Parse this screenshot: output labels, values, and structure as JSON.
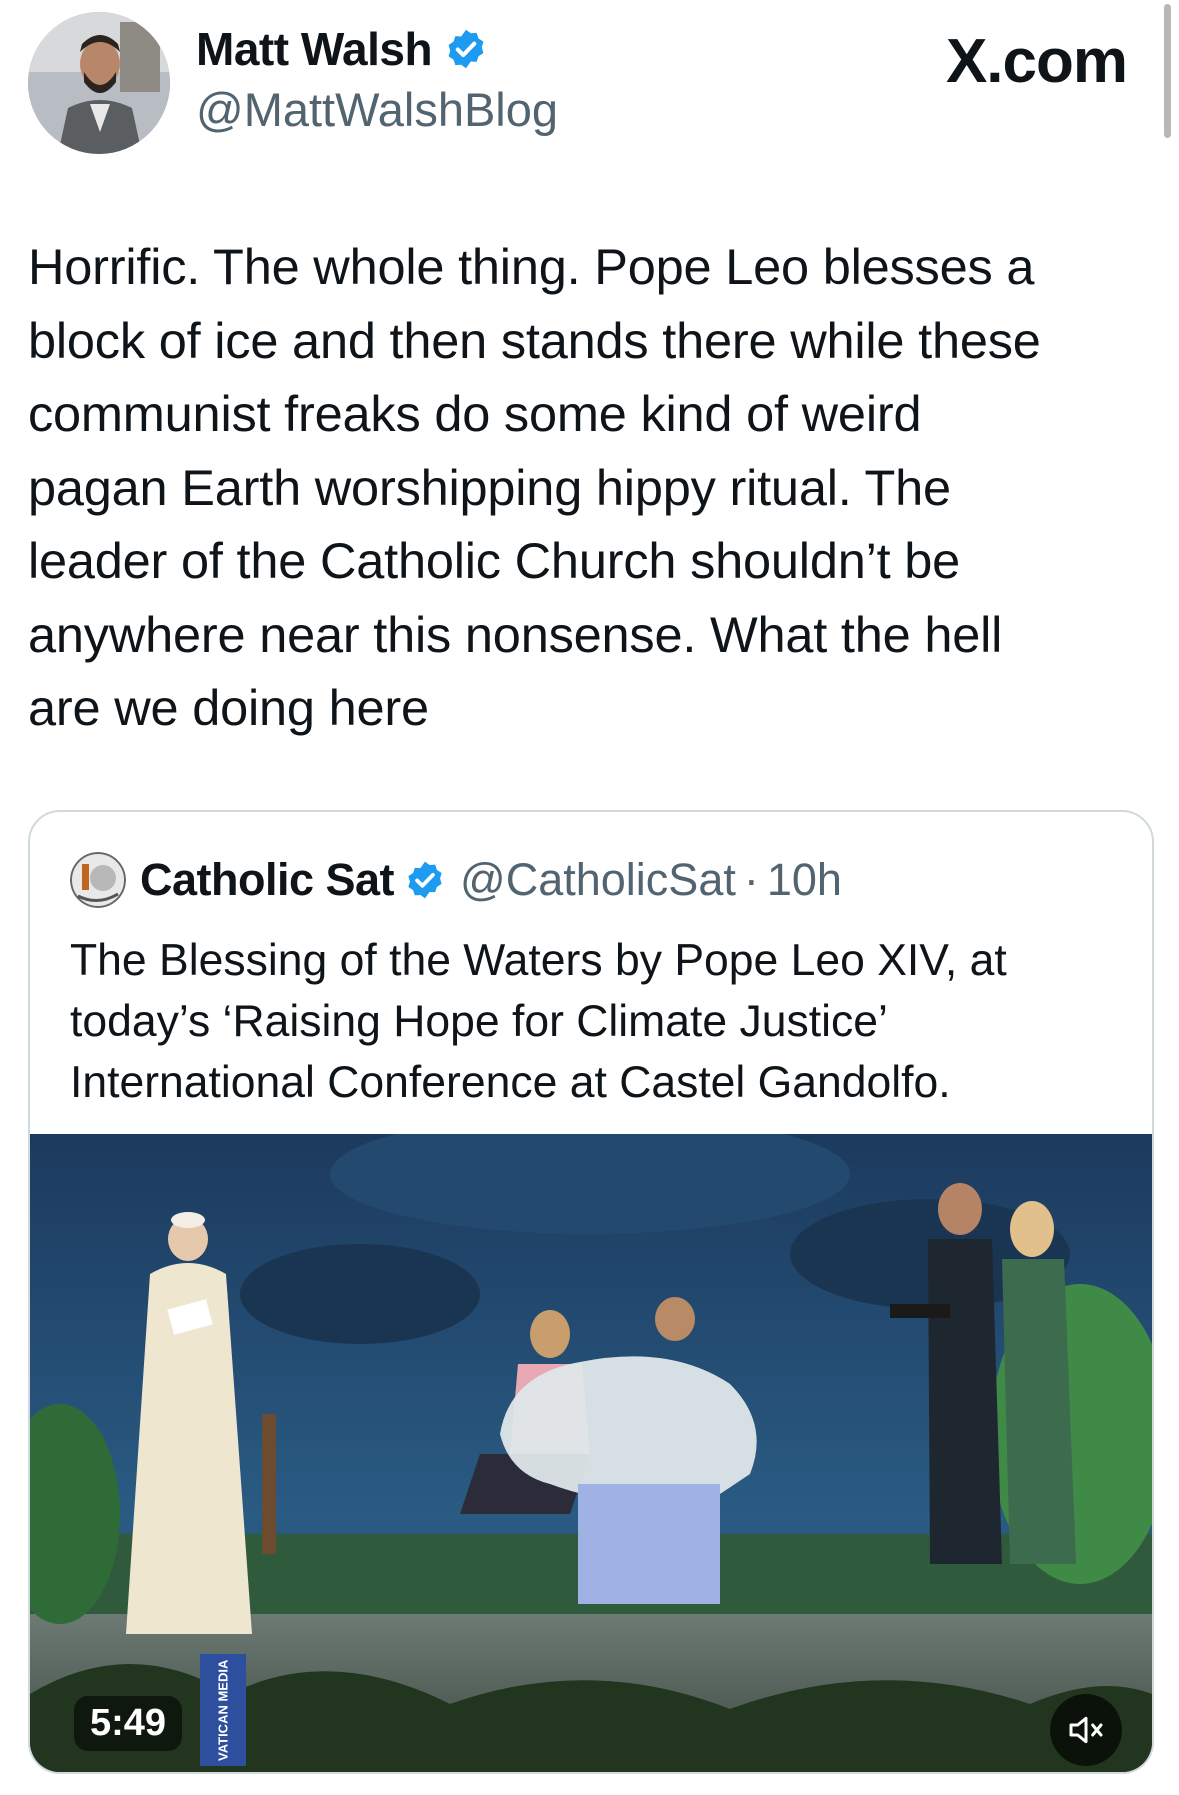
{
  "author": {
    "display_name": "Matt Walsh",
    "handle": "@MattWalshBlog",
    "verified": true
  },
  "brand": "X.com",
  "tweet": {
    "lines": [
      "Horrific. The whole thing. Pope Leo blesses a",
      "block of ice and then stands there while these",
      "communist freaks do some kind of weird",
      "pagan Earth worshipping hippy ritual. The",
      "leader of the Catholic Church shouldn’t be",
      "anywhere near this nonsense. What the hell",
      "are we doing here"
    ]
  },
  "quoted": {
    "display_name": "Catholic Sat",
    "handle": "@CatholicSat",
    "separator": "·",
    "time": "10h",
    "verified": true,
    "lines": [
      "The Blessing of the Waters by Pope Leo XIV, at",
      "today’s ‘Raising Hope for Climate Justice’",
      "International Conference at Castel Gandolfo."
    ],
    "media": {
      "duration": "5:49",
      "watermark": "VATICAN MEDIA",
      "muted": true
    }
  },
  "colors": {
    "verified": "#1d9bf0",
    "text": "#0f1419",
    "secondary": "#536471",
    "border": "#cfd9de"
  }
}
